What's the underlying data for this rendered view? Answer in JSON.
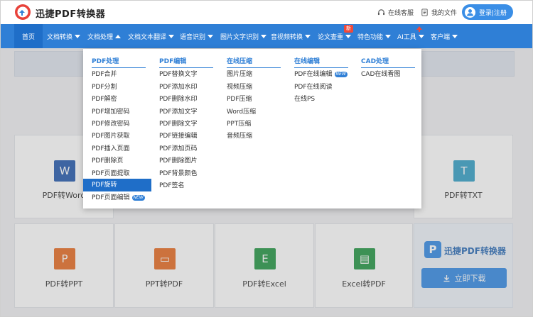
{
  "header": {
    "brand": "迅捷PDF转换器",
    "support": "在线客服",
    "my_files": "我的文件",
    "login": "登录|注册"
  },
  "nav": {
    "items": [
      {
        "label": "首页"
      },
      {
        "label": "文档转换"
      },
      {
        "label": "文档处理"
      },
      {
        "label": "文档文本翻译"
      },
      {
        "label": "语音识别"
      },
      {
        "label": "图片文字识别"
      },
      {
        "label": "音视频转换"
      },
      {
        "label": "论文查重"
      },
      {
        "label": "特色功能"
      },
      {
        "label": "AI工具"
      },
      {
        "label": "客户端"
      }
    ],
    "new_badge": "新"
  },
  "dropdown": {
    "columns": [
      {
        "title": "PDF处理",
        "items": [
          "PDF合并",
          "PDF分割",
          "PDF解密",
          "PDF增加密码",
          "PDF修改密码",
          "PDF图片获取",
          "PDF插入页面",
          "PDF删除页",
          "PDF页面提取",
          "PDF旋转",
          "PDF页面编辑"
        ]
      },
      {
        "title": "PDF编辑",
        "items": [
          "PDF替换文字",
          "PDF添加水印",
          "PDF删除水印",
          "PDF添加文字",
          "PDF删除文字",
          "PDF链接编辑",
          "PDF添加页码",
          "PDF删除图片",
          "PDF背景颜色",
          "PDF签名"
        ]
      },
      {
        "title": "在线压缩",
        "items": [
          "图片压缩",
          "视频压缩",
          "PDF压缩",
          "Word压缩",
          "PPT压缩",
          "音频压缩"
        ]
      },
      {
        "title": "在线编辑",
        "items": [
          "PDF在线编辑",
          "PDF在线阅读",
          "在线PS"
        ]
      },
      {
        "title": "CAD处理",
        "items": [
          "CAD在线看图"
        ]
      }
    ],
    "new_tag": "NEW"
  },
  "cards": {
    "row1": [
      {
        "label": "PDF转Word",
        "icon_text": "W",
        "color": "#2b5fb0"
      },
      {
        "label": "PDF转TXT",
        "icon_text": "T",
        "color": "#3aa3c8"
      }
    ],
    "row2": [
      {
        "label": "PDF转PPT",
        "icon_text": "P",
        "color": "#e8702a"
      },
      {
        "label": "PPT转PDF",
        "icon_text": "▭",
        "color": "#e8702a"
      },
      {
        "label": "PDF转Excel",
        "icon_text": "E",
        "color": "#2a9a4a"
      },
      {
        "label": "Excel转PDF",
        "icon_text": "▤",
        "color": "#2a9a4a"
      }
    ]
  },
  "promo": {
    "name": "迅捷PDF转换器",
    "logo_letter": "P",
    "download": "立即下载"
  },
  "colors": {
    "nav_blue": "#2f7fd6",
    "nav_active": "#1f6ec8",
    "button_blue": "#3a8ee6",
    "new_red": "#f04a3a"
  }
}
